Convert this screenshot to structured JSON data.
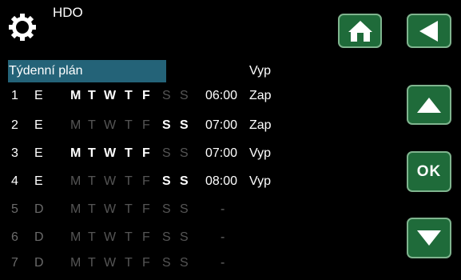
{
  "header": {
    "title": "HDO"
  },
  "table": {
    "header_label": "Týdenní plán",
    "header_state": "Vyp",
    "day_letters": [
      "M",
      "T",
      "W",
      "T",
      "F",
      "S",
      "S"
    ],
    "rows": [
      {
        "num": "1",
        "type": "E",
        "days": [
          true,
          true,
          true,
          true,
          true,
          false,
          false
        ],
        "time": "06:00",
        "state": "Zap",
        "active": true
      },
      {
        "num": "2",
        "type": "E",
        "days": [
          false,
          false,
          false,
          false,
          false,
          true,
          true
        ],
        "time": "07:00",
        "state": "Zap",
        "active": true
      },
      {
        "num": "3",
        "type": "E",
        "days": [
          true,
          true,
          true,
          true,
          true,
          false,
          false
        ],
        "time": "07:00",
        "state": "Vyp",
        "active": true
      },
      {
        "num": "4",
        "type": "E",
        "days": [
          false,
          false,
          false,
          false,
          false,
          true,
          true
        ],
        "time": "08:00",
        "state": "Vyp",
        "active": true
      },
      {
        "num": "5",
        "type": "D",
        "days": [
          false,
          false,
          false,
          false,
          false,
          false,
          false
        ],
        "time": "-",
        "state": "",
        "active": false
      },
      {
        "num": "6",
        "type": "D",
        "days": [
          false,
          false,
          false,
          false,
          false,
          false,
          false
        ],
        "time": "-",
        "state": "",
        "active": false
      },
      {
        "num": "7",
        "type": "D",
        "days": [
          false,
          false,
          false,
          false,
          false,
          false,
          false
        ],
        "time": "-",
        "state": "",
        "active": false
      }
    ]
  },
  "buttons": {
    "ok_label": "OK"
  },
  "icons": {
    "title": "gear-icon",
    "home": "home-icon",
    "back": "back-arrow-icon",
    "up": "up-arrow-icon",
    "down": "down-arrow-icon"
  },
  "colors": {
    "background": "#000000",
    "button_fill": "#1f6b3a",
    "button_border": "#7fb48e",
    "header_bar": "#246378",
    "inactive_text": "#555555"
  }
}
